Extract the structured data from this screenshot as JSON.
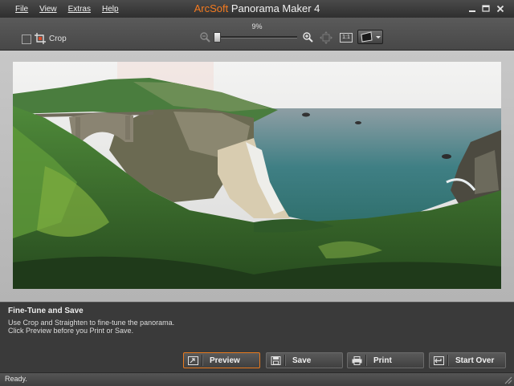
{
  "menu": {
    "items": [
      {
        "label": "File"
      },
      {
        "label": "View"
      },
      {
        "label": "Extras"
      },
      {
        "label": "Help"
      }
    ]
  },
  "window": {
    "brand": "ArcSoft",
    "product": "Panorama Maker 4",
    "accent_color": "#f47b20"
  },
  "toolbar": {
    "crop_label": "Crop",
    "crop_checked": false,
    "zoom_value": "9%",
    "zoom_level": 0.02,
    "actual_size_label": "1:1",
    "icons": [
      "crop-icon",
      "zoom-out-icon",
      "zoom-in-icon",
      "fit-to-window-icon",
      "view-mode-icon"
    ]
  },
  "canvas": {
    "image_subject": "coastal panorama"
  },
  "info": {
    "title": "Fine-Tune and Save",
    "line1": "Use Crop and Straighten to fine-tune the panorama.",
    "line2": "Click Preview before you Print or Save."
  },
  "actions": {
    "preview_label": "Preview",
    "save_label": "Save",
    "print_label": "Print",
    "start_over_label": "Start Over",
    "active": "Preview",
    "active_color": "#e87a1e"
  },
  "status": {
    "text": "Ready."
  }
}
